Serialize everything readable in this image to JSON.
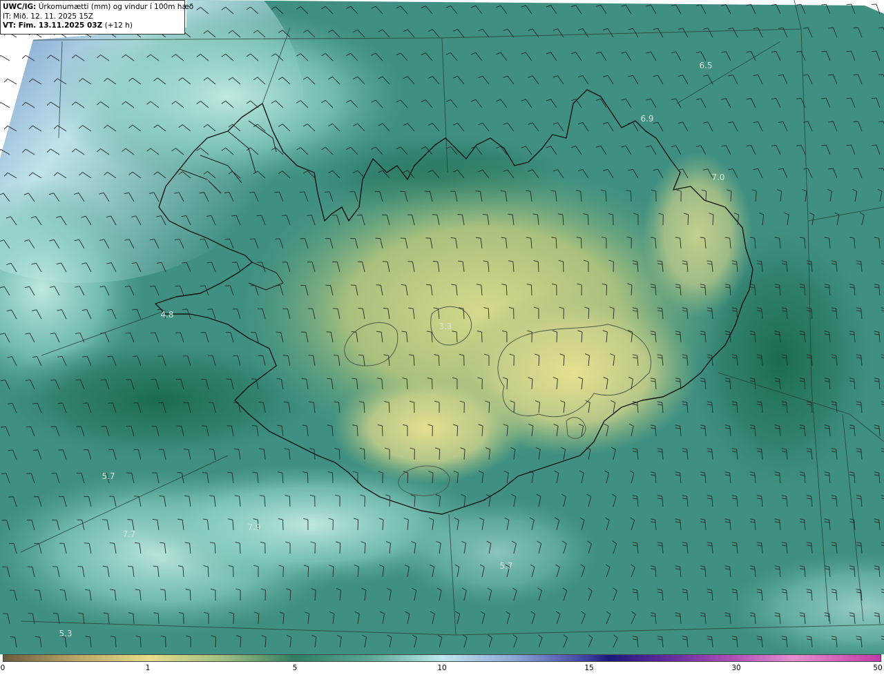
{
  "header": {
    "line1_bold": "UWC/IG:",
    "line1_rest": " Úrkomumætti (mm) og vindur í 100m hæð",
    "line2": "IT: Mið. 12. 11. 2025 15Z",
    "line3_bold": "VT: Fim. 13.11.2025 03Z",
    "line3_rest": " (+12 h)"
  },
  "colors": {
    "field_base": "#3f8f82",
    "field_dark": "#1f6b55",
    "field_light": "#7fc9b8",
    "field_yellow": "#d9dc8a",
    "field_blue": "#4f6fbf",
    "coastline": "#1a1a1a",
    "barb": "#262626"
  },
  "value_labels": [
    "6.5",
    "6.9",
    "7.0",
    "4.8",
    "3.3",
    "5.7",
    "7.7",
    "7.9",
    "5.7",
    "5.3"
  ],
  "colorbar": {
    "ticks": [
      "0",
      "1",
      "5",
      "10",
      "15",
      "30",
      "50"
    ]
  }
}
